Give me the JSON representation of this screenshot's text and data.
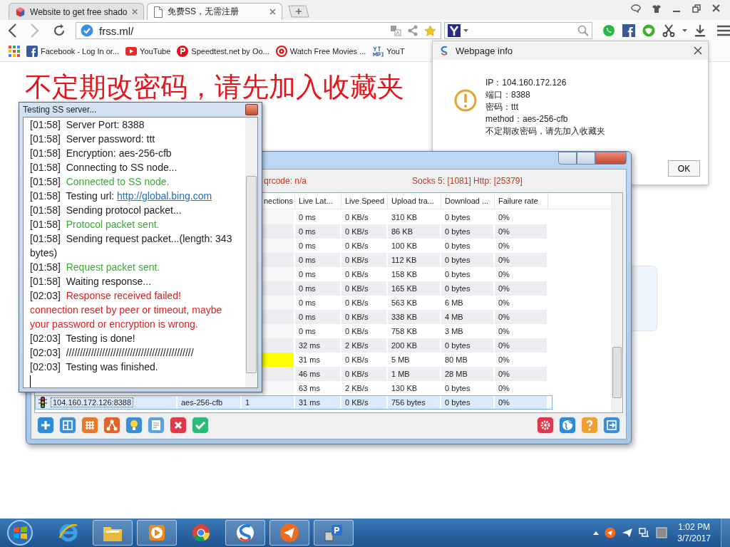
{
  "browser": {
    "tabs": [
      {
        "title": "Website to get free shado",
        "kind": "cube",
        "selected": false
      },
      {
        "title": "免费SS，无需注册",
        "kind": "page",
        "selected": true
      }
    ],
    "address": {
      "value": "frss.ml/"
    },
    "bookmarks": [
      {
        "label": "Facebook - Log In or...",
        "kind": "facebook"
      },
      {
        "label": "YouTube",
        "kind": "youtube"
      },
      {
        "label": "Speedtest.net by Oo...",
        "kind": "speedtest"
      },
      {
        "label": "Watch Free Movies ...",
        "kind": "movies"
      },
      {
        "label": "YouT",
        "kind": "mp3"
      }
    ]
  },
  "page": {
    "heading": "不定期改密码，请先加入收藏夹"
  },
  "info_dialog": {
    "title": "Webpage info",
    "lines": [
      "IP：104.160.172.126",
      "端口：8388",
      "密码：ttt",
      "method：aes-256-cfb",
      "不定期改密码，请先加入收藏夹"
    ],
    "ok": "OK"
  },
  "ss_window": {
    "status_left": "qrcode: n/a",
    "status_right": "Socks 5: [1081] Http: [25379]",
    "columns": [
      "nections",
      "Live Lat...",
      "Live Speed",
      "Upload tra...",
      "Download ...",
      "Failure rate"
    ],
    "rows": [
      {
        "latency": "0 ms",
        "speed": "0 KB/s",
        "upload": "310 KB",
        "download": "0 bytes",
        "failure": "0%",
        "highlighted": false,
        "selected": false
      },
      {
        "latency": "0 ms",
        "speed": "0 KB/s",
        "upload": "86 KB",
        "download": "0 bytes",
        "failure": "0%",
        "highlighted": false,
        "selected": false
      },
      {
        "latency": "0 ms",
        "speed": "0 KB/s",
        "upload": "100 KB",
        "download": "0 bytes",
        "failure": "0%",
        "highlighted": false,
        "selected": false
      },
      {
        "latency": "0 ms",
        "speed": "0 KB/s",
        "upload": "112 KB",
        "download": "0 bytes",
        "failure": "0%",
        "highlighted": false,
        "selected": false
      },
      {
        "latency": "0 ms",
        "speed": "0 KB/s",
        "upload": "158 KB",
        "download": "0 bytes",
        "failure": "0%",
        "highlighted": false,
        "selected": false
      },
      {
        "latency": "0 ms",
        "speed": "0 KB/s",
        "upload": "165 KB",
        "download": "0 bytes",
        "failure": "0%",
        "highlighted": false,
        "selected": false
      },
      {
        "latency": "0 ms",
        "speed": "0 KB/s",
        "upload": "563 KB",
        "download": "6 MB",
        "failure": "0%",
        "highlighted": false,
        "selected": false
      },
      {
        "latency": "0 ms",
        "speed": "0 KB/s",
        "upload": "338 KB",
        "download": "4 MB",
        "failure": "0%",
        "highlighted": false,
        "selected": false
      },
      {
        "latency": "0 ms",
        "speed": "0 KB/s",
        "upload": "758 KB",
        "download": "3 MB",
        "failure": "0%",
        "highlighted": false,
        "selected": false
      },
      {
        "latency": "32 ms",
        "speed": "2 KB/s",
        "upload": "200 KB",
        "download": "0 bytes",
        "failure": "0%",
        "highlighted": false,
        "selected": false
      },
      {
        "latency": "31 ms",
        "speed": "0 KB/s",
        "upload": "5 MB",
        "download": "80 MB",
        "failure": "0%",
        "highlighted": true,
        "selected": false
      },
      {
        "latency": "46 ms",
        "speed": "0 KB/s",
        "upload": "1 MB",
        "download": "28 MB",
        "failure": "0%",
        "highlighted": false,
        "selected": false
      },
      {
        "latency": "63 ms",
        "speed": "2 KB/s",
        "upload": "130 KB",
        "download": "0 bytes",
        "failure": "0%",
        "highlighted": false,
        "selected": false
      },
      {
        "server": "104.160.172.126:8388",
        "method": "aes-256-cfb",
        "connections": "1",
        "latency": "31 ms",
        "speed": "0 KB/s",
        "upload": "756 bytes",
        "download": "0 bytes",
        "failure": "0%",
        "highlighted": false,
        "selected": true
      }
    ]
  },
  "test_window": {
    "title": "Testing SS server...",
    "log": [
      {
        "time": "[01:58]",
        "text": "Server Port: 8388",
        "kind": "normal"
      },
      {
        "time": "[01:58]",
        "text": "Server password: ttt",
        "kind": "normal"
      },
      {
        "time": "[01:58]",
        "text": "Encryption: aes-256-cfb",
        "kind": "normal"
      },
      {
        "time": "[01:58]",
        "text": "Connecting to SS node...",
        "kind": "normal"
      },
      {
        "time": "[01:58]",
        "text": "Connected to SS node.",
        "kind": "success"
      },
      {
        "time": "[01:58]",
        "text": "Testing url: ",
        "link": "http://global.bing.com",
        "kind": "normal"
      },
      {
        "time": "[01:58]",
        "text": "Sending protocol packet...",
        "kind": "normal"
      },
      {
        "time": "[01:58]",
        "text": "Protocol packet sent.",
        "kind": "success"
      },
      {
        "time": "[01:58]",
        "text": "Sending request packet...(length: 343 bytes)",
        "kind": "normal"
      },
      {
        "time": "[01:58]",
        "text": "Request packet sent.",
        "kind": "success"
      },
      {
        "time": "[01:58]",
        "text": "Waiting response...",
        "kind": "normal"
      },
      {
        "time": "[02:03]",
        "text": "Response received failed!",
        "kind": "error"
      },
      {
        "text": "connection reset by peer or timeout, maybe your password or encryption is wrong.",
        "kind": "error"
      },
      {
        "time": "[02:03]",
        "text": "Testing is done!",
        "kind": "normal"
      },
      {
        "time": "[02:03]",
        "text": "//////////////////////////////////////////////",
        "kind": "normal"
      },
      {
        "time": "[02:03]",
        "text": "Testing was finished.",
        "kind": "normal"
      }
    ]
  },
  "taskbar": {
    "apps": [
      {
        "kind": "ie",
        "open": false
      },
      {
        "kind": "folder",
        "open": true
      },
      {
        "kind": "player",
        "open": true
      },
      {
        "kind": "chrome",
        "open": false
      },
      {
        "kind": "swirl",
        "open": true
      },
      {
        "kind": "plane",
        "open": true
      },
      {
        "kind": "network",
        "open": true
      }
    ],
    "time": "1:02 PM",
    "date": "3/7/2017"
  }
}
